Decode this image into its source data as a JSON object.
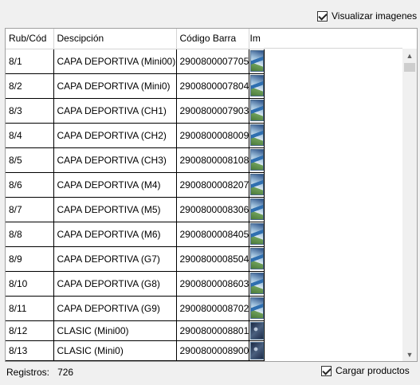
{
  "options": {
    "show_images_label": "Visualizar imagenes",
    "show_images_checked": true,
    "load_products_label": "Cargar productos",
    "load_products_checked": true
  },
  "grid": {
    "columns": [
      "Rub/Cód",
      "Descipción",
      "Código Barra",
      "Im"
    ],
    "rows": [
      {
        "code": "8/1",
        "desc": "CAPA DEPORTIVA (Mini00)",
        "barcode": "2900800007705",
        "image": "thumb-icon"
      },
      {
        "code": "8/2",
        "desc": "CAPA DEPORTIVA (Mini0)",
        "barcode": "2900800007804",
        "image": "thumb-icon"
      },
      {
        "code": "8/3",
        "desc": "CAPA DEPORTIVA (CH1)",
        "barcode": "2900800007903",
        "image": "thumb-icon"
      },
      {
        "code": "8/4",
        "desc": "CAPA DEPORTIVA (CH2)",
        "barcode": "2900800008009",
        "image": "thumb-icon"
      },
      {
        "code": "8/5",
        "desc": "CAPA DEPORTIVA (CH3)",
        "barcode": "2900800008108",
        "image": "thumb-icon"
      },
      {
        "code": "8/6",
        "desc": "CAPA DEPORTIVA (M4)",
        "barcode": "2900800008207",
        "image": "thumb-icon"
      },
      {
        "code": "8/7",
        "desc": "CAPA DEPORTIVA (M5)",
        "barcode": "2900800008306",
        "image": "thumb-icon"
      },
      {
        "code": "8/8",
        "desc": "CAPA DEPORTIVA (M6)",
        "barcode": "2900800008405",
        "image": "thumb-icon"
      },
      {
        "code": "8/9",
        "desc": "CAPA DEPORTIVA (G7)",
        "barcode": "2900800008504",
        "image": "thumb-icon"
      },
      {
        "code": "8/10",
        "desc": "CAPA DEPORTIVA (G8)",
        "barcode": "2900800008603",
        "image": "thumb-icon"
      },
      {
        "code": "8/11",
        "desc": "CAPA DEPORTIVA (G9)",
        "barcode": "2900800008702",
        "image": "thumb-icon"
      },
      {
        "code": "8/12",
        "desc": "CLASIC (Mini00)",
        "barcode": "2900800008801",
        "image": "thumb-dark-icon"
      },
      {
        "code": "8/13",
        "desc": "CLASIC (Mini0)",
        "barcode": "2900800008900",
        "image": "thumb-dark-icon"
      }
    ]
  },
  "footer": {
    "records_label": "Registros:",
    "records_count": "726"
  }
}
